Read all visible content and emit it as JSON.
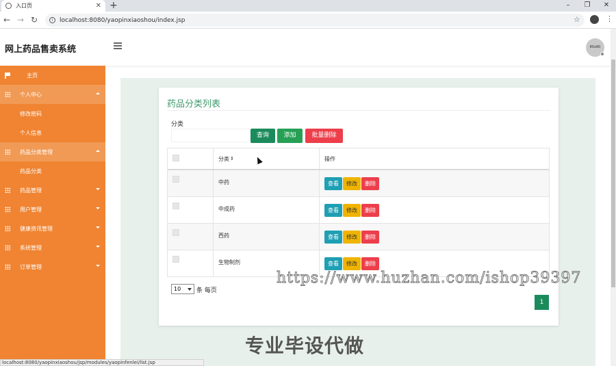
{
  "browser": {
    "tab_title": "入口页",
    "tab_close": "✕",
    "new_tab": "+",
    "url": "localhost:8080/yaopinxiaoshou/index.jsp",
    "win_min": "–",
    "win_max": "❐",
    "win_close": "✕"
  },
  "header": {
    "app_title": "网上药品售卖系统",
    "avatar_text": "80x80"
  },
  "sidebar": {
    "items": [
      {
        "label": "主页"
      },
      {
        "label": "个人中心"
      },
      {
        "label": "修改密码"
      },
      {
        "label": "个人信息"
      },
      {
        "label": "药品分类管理"
      },
      {
        "label": "药品分类"
      },
      {
        "label": "药品管理"
      },
      {
        "label": "用户管理"
      },
      {
        "label": "健康资讯管理"
      },
      {
        "label": "系统管理"
      },
      {
        "label": "订单管理"
      }
    ]
  },
  "main": {
    "title": "药品分类列表",
    "filter_label": "分类",
    "buttons": {
      "query": "查询",
      "add": "添加",
      "batch_delete": "批量删除"
    },
    "table": {
      "headers": [
        "分类",
        "操作"
      ],
      "rows": [
        {
          "category": "中药"
        },
        {
          "category": "中成药"
        },
        {
          "category": "西药"
        },
        {
          "category": "生物制剂"
        }
      ],
      "actions": {
        "view": "查看",
        "edit": "修改",
        "delete": "删除"
      }
    },
    "pagination": {
      "page_size": "10",
      "page_size_suffix": "条 每页",
      "current_page": "1"
    }
  },
  "overlays": {
    "watermark_url": "https://www.huzhan.com/ishop39397",
    "watermark_cn": "专业毕设代做"
  },
  "status_bar": "localhost:8080/yaopinxiaoshou/jsp/modules/yaopinfenlei/list.jsp"
}
